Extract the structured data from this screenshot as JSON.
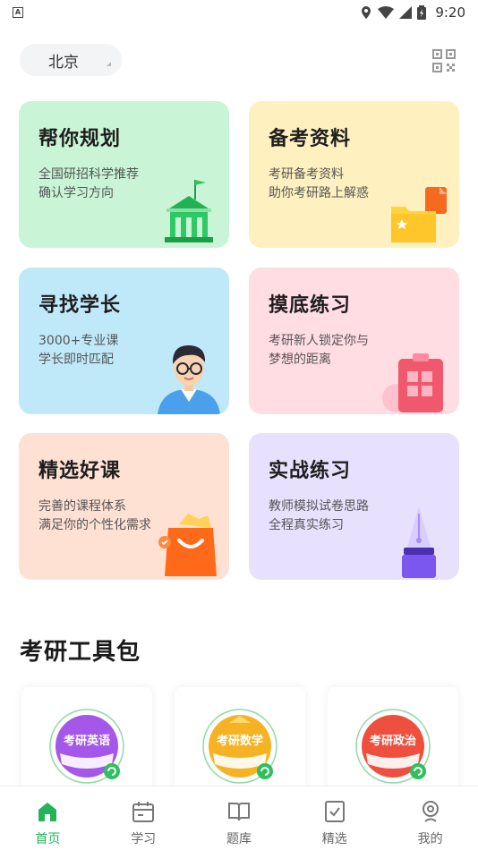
{
  "status_bar": {
    "time": "9:20",
    "app_letter": "A"
  },
  "header": {
    "city": "北京"
  },
  "cards": [
    {
      "title": "帮你规划",
      "lines": [
        "全国研招科学推荐",
        "确认学习方向"
      ]
    },
    {
      "title": "备考资料",
      "lines": [
        "考研备考资料",
        "助你考研路上解惑"
      ]
    },
    {
      "title": "寻找学长",
      "lines": [
        "3000+专业课",
        "学长即时匹配"
      ]
    },
    {
      "title": "摸底练习",
      "lines": [
        "考研新人锁定你与",
        "梦想的距离"
      ]
    },
    {
      "title": "精选好课",
      "lines": [
        "完善的课程体系",
        "满足你的个性化需求"
      ]
    },
    {
      "title": "实战练习",
      "lines": [
        "教师模拟试卷思路",
        "全程真实练习"
      ]
    }
  ],
  "toolkit": {
    "title": "考研工具包",
    "items": [
      {
        "label": "考研英语",
        "color": "#a457e8"
      },
      {
        "label": "考研数学",
        "color": "#f5b324"
      },
      {
        "label": "考研政治",
        "color": "#ef4f3d"
      }
    ]
  },
  "tabs": [
    {
      "label": "首页",
      "icon": "home-icon"
    },
    {
      "label": "学习",
      "icon": "calendar-icon"
    },
    {
      "label": "题库",
      "icon": "book-icon"
    },
    {
      "label": "精选",
      "icon": "checkbox-icon"
    },
    {
      "label": "我的",
      "icon": "profile-icon"
    }
  ],
  "colors": {
    "accent": "#22b35b"
  }
}
